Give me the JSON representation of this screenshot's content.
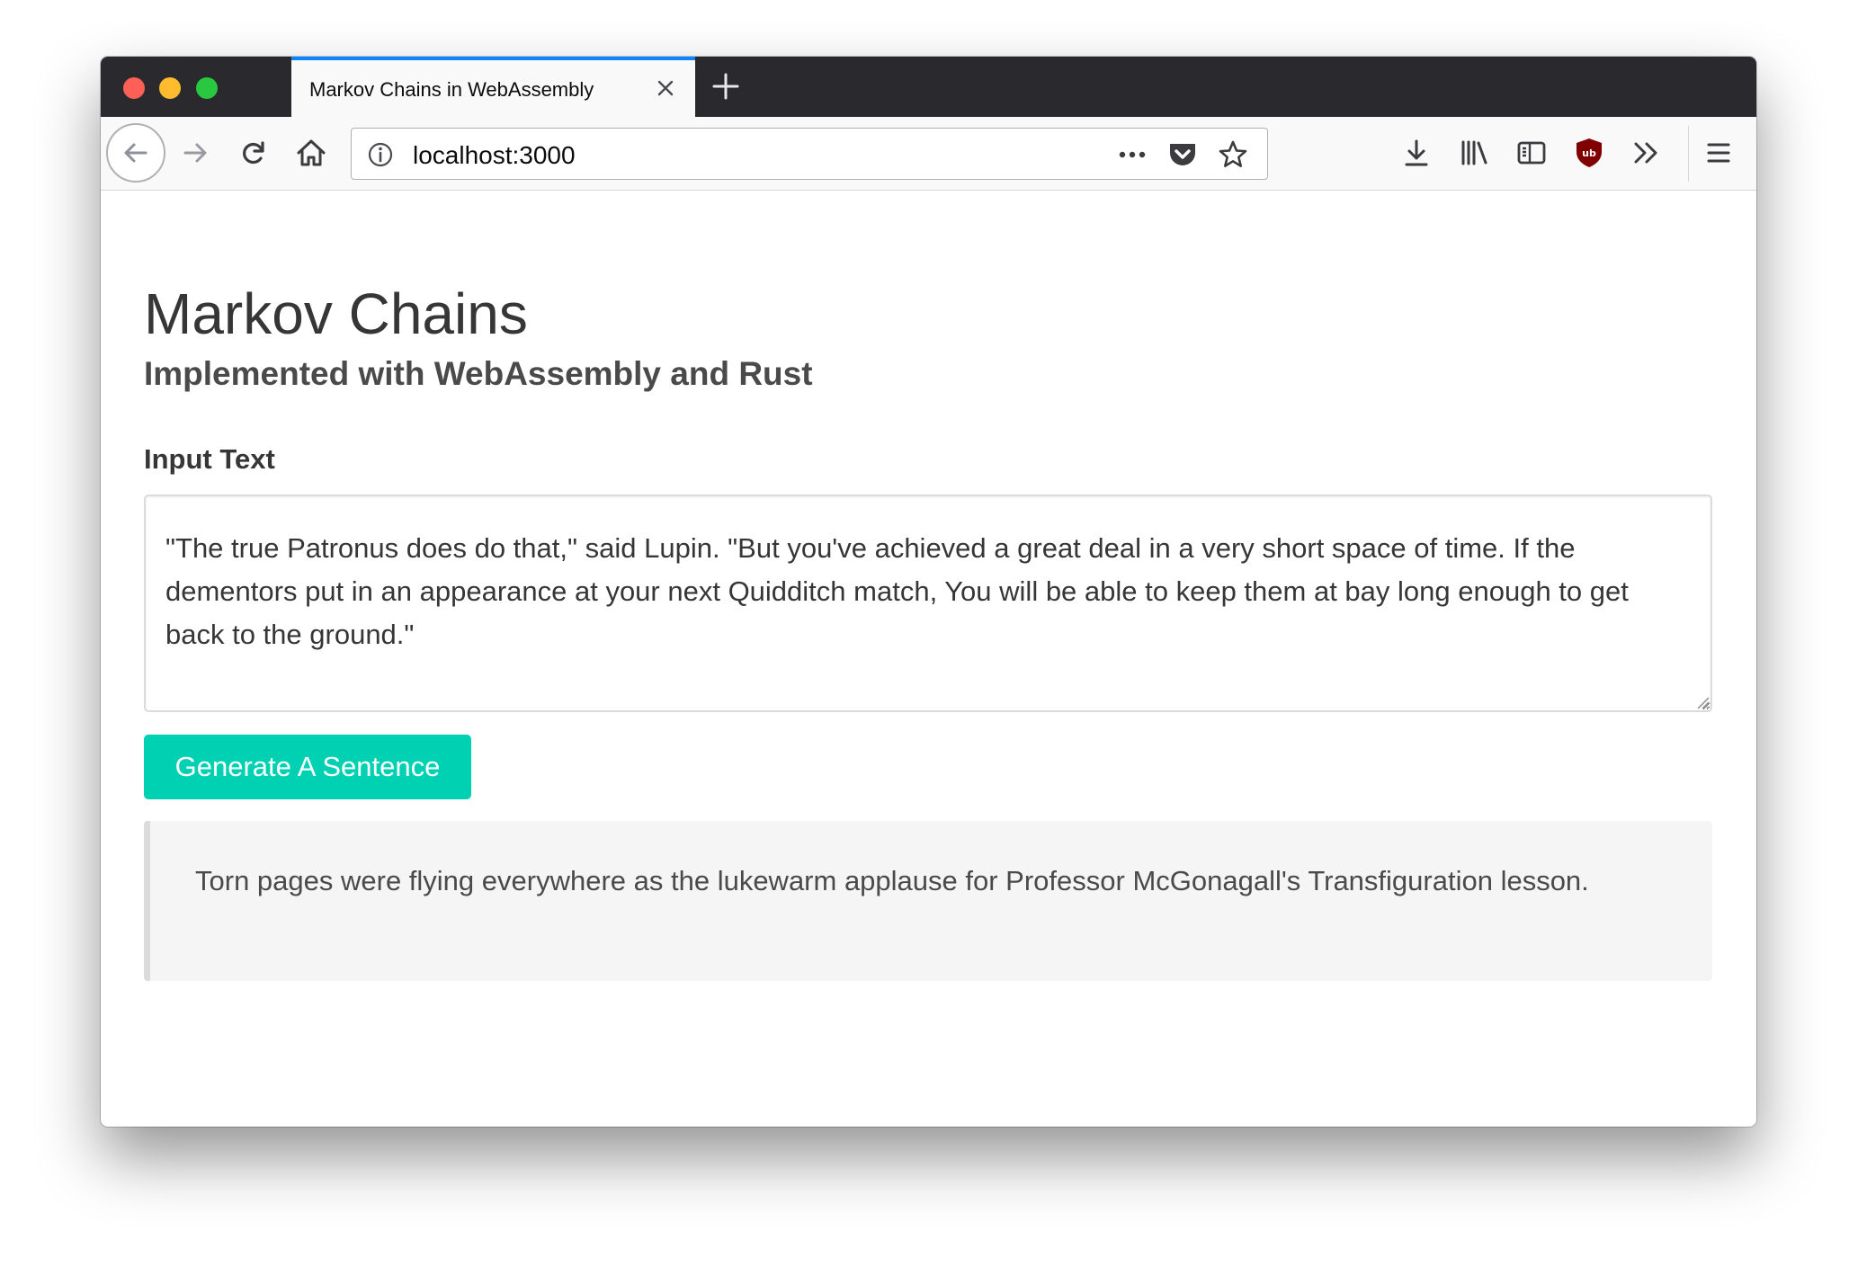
{
  "browser": {
    "tab_title": "Markov Chains in WebAssembly",
    "url": "localhost:3000",
    "accent_color": "#0a84ff",
    "icons": [
      "back-arrow-icon",
      "forward-arrow-icon",
      "reload-icon",
      "home-icon",
      "info-icon",
      "page-actions-icon",
      "pocket-icon",
      "bookmark-star-icon",
      "download-icon",
      "library-icon",
      "sidebar-icon",
      "ublock-icon",
      "overflow-chevrons-icon",
      "hamburger-menu-icon",
      "close-icon",
      "plus-icon"
    ]
  },
  "page": {
    "title": "Markov Chains",
    "subtitle": "Implemented with WebAssembly and Rust",
    "input_label": "Input Text",
    "input_value": "\"The true Patronus does do that,\" said Lupin. \"But you've achieved a great deal in a very short space of time. If the dementors put in an appearance at your next Quidditch match, You will be able to keep them at bay long enough to get back to the ground.\"",
    "generate_button_label": "Generate A Sentence",
    "generated_sentence": "Torn pages were flying everywhere as the lukewarm applause for Professor McGonagall's Transfiguration lesson.",
    "button_color": "#00d1b2"
  }
}
